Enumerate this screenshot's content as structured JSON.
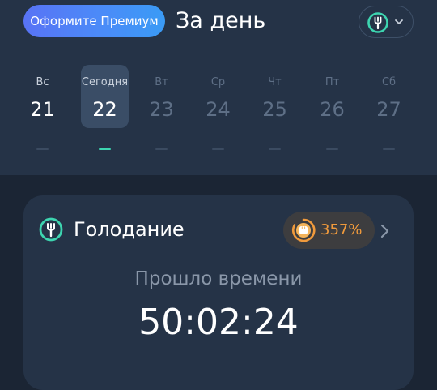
{
  "header": {
    "premium_label": "Оформите Премиум",
    "title": "За день",
    "mode_icon": "fork-circle-icon",
    "accent_color": "#3dd5b0"
  },
  "calendar": {
    "days": [
      {
        "name": "Вс",
        "num": "21",
        "state": "past"
      },
      {
        "name": "Сегодня",
        "num": "22",
        "state": "selected"
      },
      {
        "name": "Вт",
        "num": "23",
        "state": "future"
      },
      {
        "name": "Ср",
        "num": "24",
        "state": "future"
      },
      {
        "name": "Чт",
        "num": "25",
        "state": "future"
      },
      {
        "name": "Пт",
        "num": "26",
        "state": "future"
      },
      {
        "name": "Сб",
        "num": "27",
        "state": "future"
      }
    ]
  },
  "fasting": {
    "title": "Голодание",
    "percent": "357%",
    "percent_color": "#f09a3c",
    "elapsed_label": "Прошло времени",
    "elapsed_time": "50:02:24"
  }
}
